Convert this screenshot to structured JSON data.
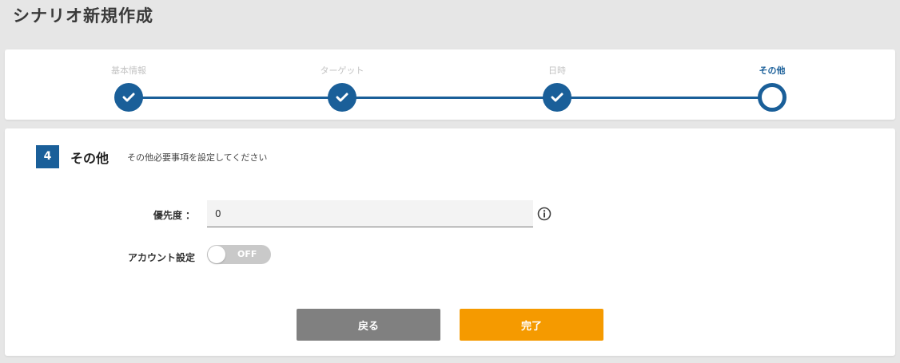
{
  "page": {
    "title": "シナリオ新規作成"
  },
  "stepper": {
    "steps": [
      {
        "label": "基本情報",
        "state": "done"
      },
      {
        "label": "ターゲット",
        "state": "done"
      },
      {
        "label": "日時",
        "state": "done"
      },
      {
        "label": "その他",
        "state": "active"
      }
    ]
  },
  "section": {
    "number": "4",
    "title": "その他",
    "description": "その他必要事項を設定してください"
  },
  "form": {
    "priority": {
      "label": "優先度 ：",
      "value": "0",
      "info_icon": "info-circle-icon"
    },
    "account": {
      "label": "アカウント設定",
      "toggle_text": "OFF",
      "toggle_on": false
    }
  },
  "buttons": {
    "back": "戻る",
    "done": "完了"
  },
  "colors": {
    "accent": "#1a5f99",
    "primary_button": "#f59a00",
    "secondary_button": "#808080",
    "background": "#e6e6e6"
  }
}
